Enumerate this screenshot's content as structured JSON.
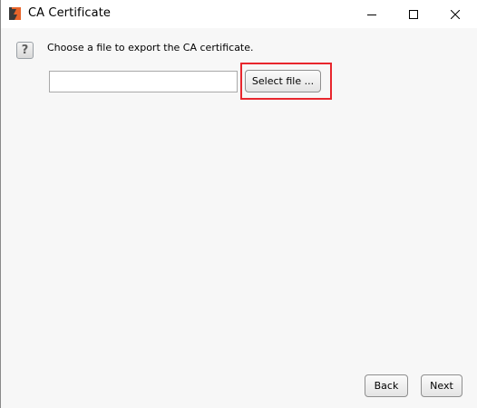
{
  "window": {
    "title": "CA Certificate",
    "icon": "app-logo-icon",
    "controls": {
      "minimize_icon": "minimize-icon",
      "maximize_icon": "maximize-icon",
      "close_icon": "close-icon"
    }
  },
  "main": {
    "help_icon_glyph": "?",
    "instruction": "Choose a file to export the CA certificate.",
    "file_input": {
      "value": "",
      "placeholder": ""
    },
    "select_file_label": "Select file ...",
    "highlight_color": "#e8262d"
  },
  "footer": {
    "back_label": "Back",
    "next_label": "Next"
  },
  "colors": {
    "content_background": "#f7f7f7",
    "app_icon_orange": "#e8642a",
    "app_icon_dark": "#3a3a3a"
  }
}
